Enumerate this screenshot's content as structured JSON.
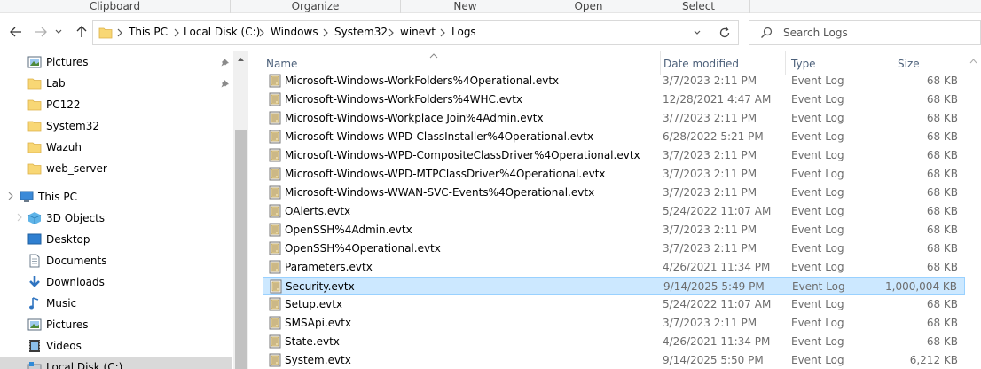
{
  "ribbon": {
    "groups": [
      "Clipboard",
      "Organize",
      "New",
      "Open",
      "Select"
    ]
  },
  "address": {
    "crumbs": [
      "This PC",
      "Local Disk (C:)",
      "Windows",
      "System32",
      "winevt",
      "Logs"
    ],
    "search_placeholder": "Search Logs"
  },
  "nav": {
    "items": [
      {
        "label": "Pictures",
        "icon": "pictures-icon",
        "pinned": true
      },
      {
        "label": "Lab",
        "icon": "folder-icon",
        "pinned": true
      },
      {
        "label": "PC122",
        "icon": "folder-icon",
        "pinned": false
      },
      {
        "label": "System32",
        "icon": "folder-icon",
        "pinned": false
      },
      {
        "label": "Wazuh",
        "icon": "folder-icon",
        "pinned": false
      },
      {
        "label": "web_server",
        "icon": "folder-icon",
        "pinned": false
      },
      {
        "label": "This PC",
        "icon": "this-pc-icon",
        "pinned": false
      },
      {
        "label": "3D Objects",
        "icon": "3d-objects-icon",
        "pinned": false
      },
      {
        "label": "Desktop",
        "icon": "desktop-icon",
        "pinned": false
      },
      {
        "label": "Documents",
        "icon": "documents-icon",
        "pinned": false
      },
      {
        "label": "Downloads",
        "icon": "downloads-icon",
        "pinned": false
      },
      {
        "label": "Music",
        "icon": "music-icon",
        "pinned": false
      },
      {
        "label": "Pictures",
        "icon": "pictures-icon",
        "pinned": false
      },
      {
        "label": "Videos",
        "icon": "videos-icon",
        "pinned": false
      },
      {
        "label": "Local Disk (C:)",
        "icon": "drive-icon",
        "pinned": false
      }
    ]
  },
  "columns": {
    "name": "Name",
    "date": "Date modified",
    "type": "Type",
    "size": "Size"
  },
  "files": [
    {
      "name": "Microsoft-Windows-WorkFolders%4Operational.evtx",
      "date": "3/7/2023 2:11 PM",
      "type": "Event Log",
      "size": "68 KB"
    },
    {
      "name": "Microsoft-Windows-WorkFolders%4WHC.evtx",
      "date": "12/28/2021 4:47 AM",
      "type": "Event Log",
      "size": "68 KB"
    },
    {
      "name": "Microsoft-Windows-Workplace Join%4Admin.evtx",
      "date": "3/7/2023 2:11 PM",
      "type": "Event Log",
      "size": "68 KB"
    },
    {
      "name": "Microsoft-Windows-WPD-ClassInstaller%4Operational.evtx",
      "date": "6/28/2022 5:21 PM",
      "type": "Event Log",
      "size": "68 KB"
    },
    {
      "name": "Microsoft-Windows-WPD-CompositeClassDriver%4Operational.evtx",
      "date": "3/7/2023 2:11 PM",
      "type": "Event Log",
      "size": "68 KB"
    },
    {
      "name": "Microsoft-Windows-WPD-MTPClassDriver%4Operational.evtx",
      "date": "3/7/2023 2:11 PM",
      "type": "Event Log",
      "size": "68 KB"
    },
    {
      "name": "Microsoft-Windows-WWAN-SVC-Events%4Operational.evtx",
      "date": "3/7/2023 2:11 PM",
      "type": "Event Log",
      "size": "68 KB"
    },
    {
      "name": "OAlerts.evtx",
      "date": "5/24/2022 11:07 AM",
      "type": "Event Log",
      "size": "68 KB"
    },
    {
      "name": "OpenSSH%4Admin.evtx",
      "date": "3/7/2023 2:11 PM",
      "type": "Event Log",
      "size": "68 KB"
    },
    {
      "name": "OpenSSH%4Operational.evtx",
      "date": "3/7/2023 2:11 PM",
      "type": "Event Log",
      "size": "68 KB"
    },
    {
      "name": "Parameters.evtx",
      "date": "4/26/2021 11:34 PM",
      "type": "Event Log",
      "size": "68 KB"
    },
    {
      "name": "Security.evtx",
      "date": "9/14/2025 5:49 PM",
      "type": "Event Log",
      "size": "1,000,004 KB",
      "selected": true
    },
    {
      "name": "Setup.evtx",
      "date": "5/24/2022 11:07 AM",
      "type": "Event Log",
      "size": "68 KB"
    },
    {
      "name": "SMSApi.evtx",
      "date": "3/7/2023 2:11 PM",
      "type": "Event Log",
      "size": "68 KB"
    },
    {
      "name": "State.evtx",
      "date": "4/26/2021 11:34 PM",
      "type": "Event Log",
      "size": "68 KB"
    },
    {
      "name": "System.evtx",
      "date": "9/14/2025 5:50 PM",
      "type": "Event Log",
      "size": "6,212 KB"
    }
  ]
}
